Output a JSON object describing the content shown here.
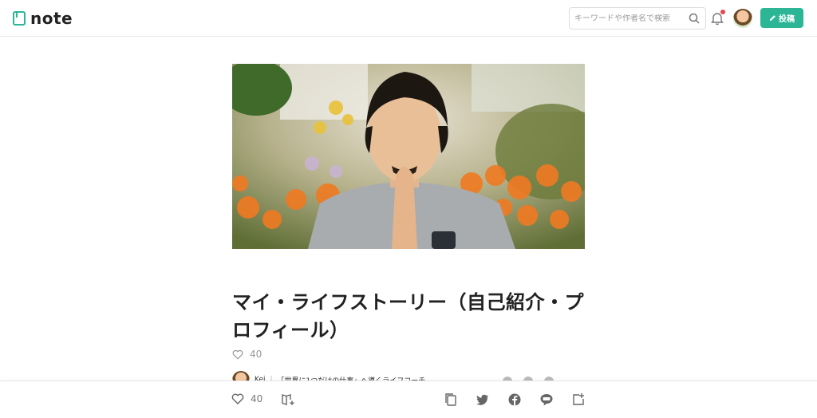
{
  "header": {
    "logo_text": "note",
    "search_placeholder": "キーワードや作者名で検索",
    "post_button_label": "投稿",
    "notification_dot_color": "#e5484d",
    "accent_color": "#2cb696"
  },
  "article": {
    "title": "マイ・ライフストーリー（自己紹介・プロフィール）",
    "like_count": "40",
    "author_name": "Kei",
    "author_separator": "|",
    "author_tagline": "「世界に1つだけの仕事」へ導くライフコーチ"
  },
  "bottom_bar": {
    "like_count": "40",
    "icons": [
      "heart-icon",
      "magazine-add-icon",
      "copy-link-icon",
      "twitter-icon",
      "facebook-icon",
      "line-icon",
      "embed-icon"
    ]
  }
}
